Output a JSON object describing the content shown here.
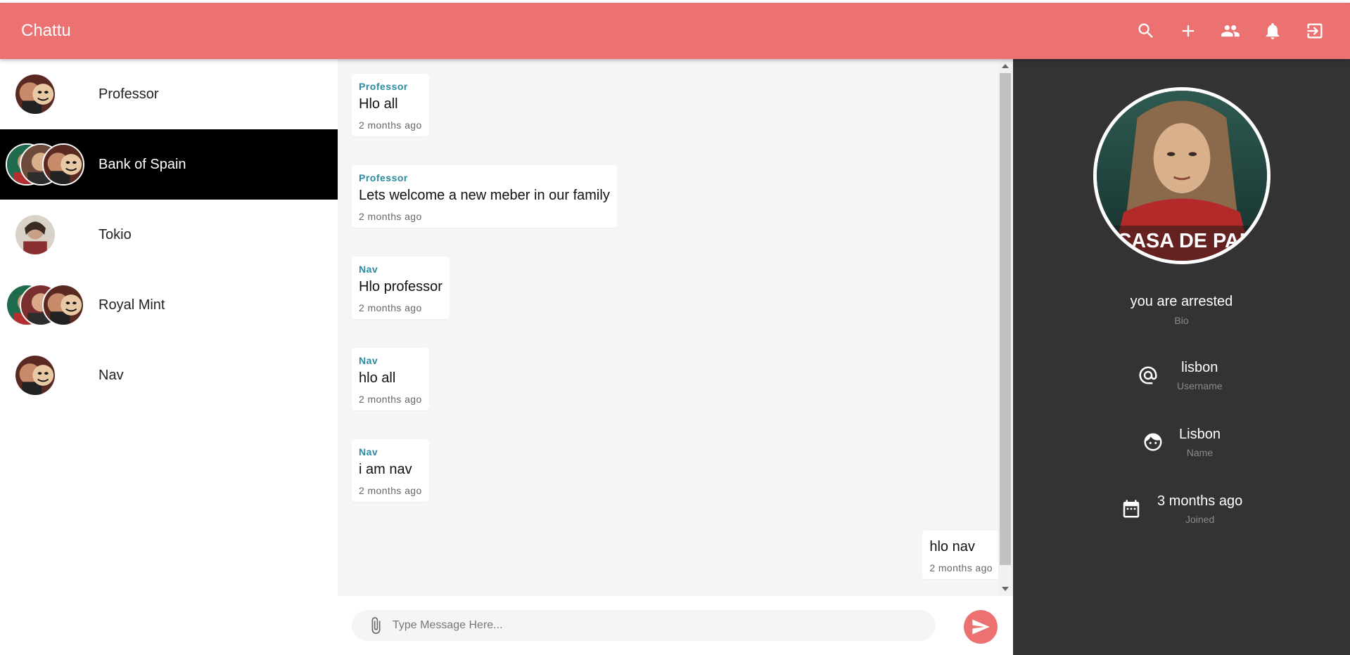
{
  "app": {
    "title": "Chattu",
    "accent": "#ec7272"
  },
  "toolbar": {
    "icons": [
      "search-icon",
      "plus-icon",
      "people-icon",
      "bell-icon",
      "logout-icon"
    ]
  },
  "sidebar": {
    "chats": [
      {
        "name": "Professor",
        "active": false
      },
      {
        "name": "Bank of Spain",
        "active": true
      },
      {
        "name": "Tokio",
        "active": false
      },
      {
        "name": "Royal Mint",
        "active": false
      },
      {
        "name": "Nav",
        "active": false
      }
    ]
  },
  "messages": [
    {
      "sender": "Professor",
      "text": "Hlo all",
      "time": "2 months ago"
    },
    {
      "sender": "Professor",
      "text": "Lets welcome a new meber in our family",
      "time": "2 months ago"
    },
    {
      "sender": "Nav",
      "text": "Hlo professor",
      "time": "2 months ago"
    },
    {
      "sender": "Nav",
      "text": "hlo all",
      "time": "2 months ago"
    },
    {
      "sender": "Nav",
      "text": "i am nav",
      "time": "2 months ago"
    },
    {
      "sender": "",
      "text": "hlo nav",
      "time": "2 months ago"
    }
  ],
  "composer": {
    "placeholder": "Type Message Here..."
  },
  "profile": {
    "bio": {
      "value": "you are arrested",
      "label": "Bio"
    },
    "username": {
      "value": "lisbon",
      "label": "Username"
    },
    "name": {
      "value": "Lisbon",
      "label": "Name"
    },
    "joined": {
      "value": "3 months ago",
      "label": "Joined"
    },
    "poster_text": "LA CASA DE PAPEL"
  }
}
